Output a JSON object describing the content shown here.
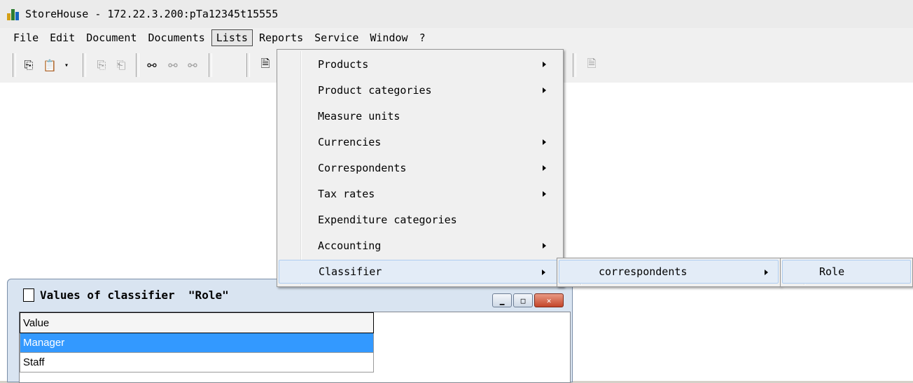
{
  "window": {
    "title": "StoreHouse - 172.22.3.200:pTa12345t15555"
  },
  "menubar": {
    "items": [
      {
        "label": "File"
      },
      {
        "label": "Edit"
      },
      {
        "label": "Document"
      },
      {
        "label": "Documents"
      },
      {
        "label": "Lists"
      },
      {
        "label": "Reports"
      },
      {
        "label": "Service"
      },
      {
        "label": "Window"
      },
      {
        "label": "?"
      }
    ]
  },
  "lists_menu": {
    "items": [
      {
        "label": "Products"
      },
      {
        "label": "Product categories"
      },
      {
        "label": "Measure units"
      },
      {
        "label": "Currencies"
      },
      {
        "label": "Correspondents"
      },
      {
        "label": "Tax rates"
      },
      {
        "label": "Expenditure categories"
      },
      {
        "label": "Accounting"
      },
      {
        "label": "Classifier"
      }
    ]
  },
  "classifier_submenu": {
    "item": "correspondents"
  },
  "correspondents_submenu": {
    "item": "Role"
  },
  "child_window": {
    "title": "Values of classifier  \"Role\"",
    "column_header": "Value",
    "rows": [
      {
        "value": "Manager"
      },
      {
        "value": "Staff"
      }
    ]
  },
  "colors": {
    "selection": "#3399ff",
    "menu_highlight": "#e3ecf7",
    "close_button": "#c4462a"
  }
}
